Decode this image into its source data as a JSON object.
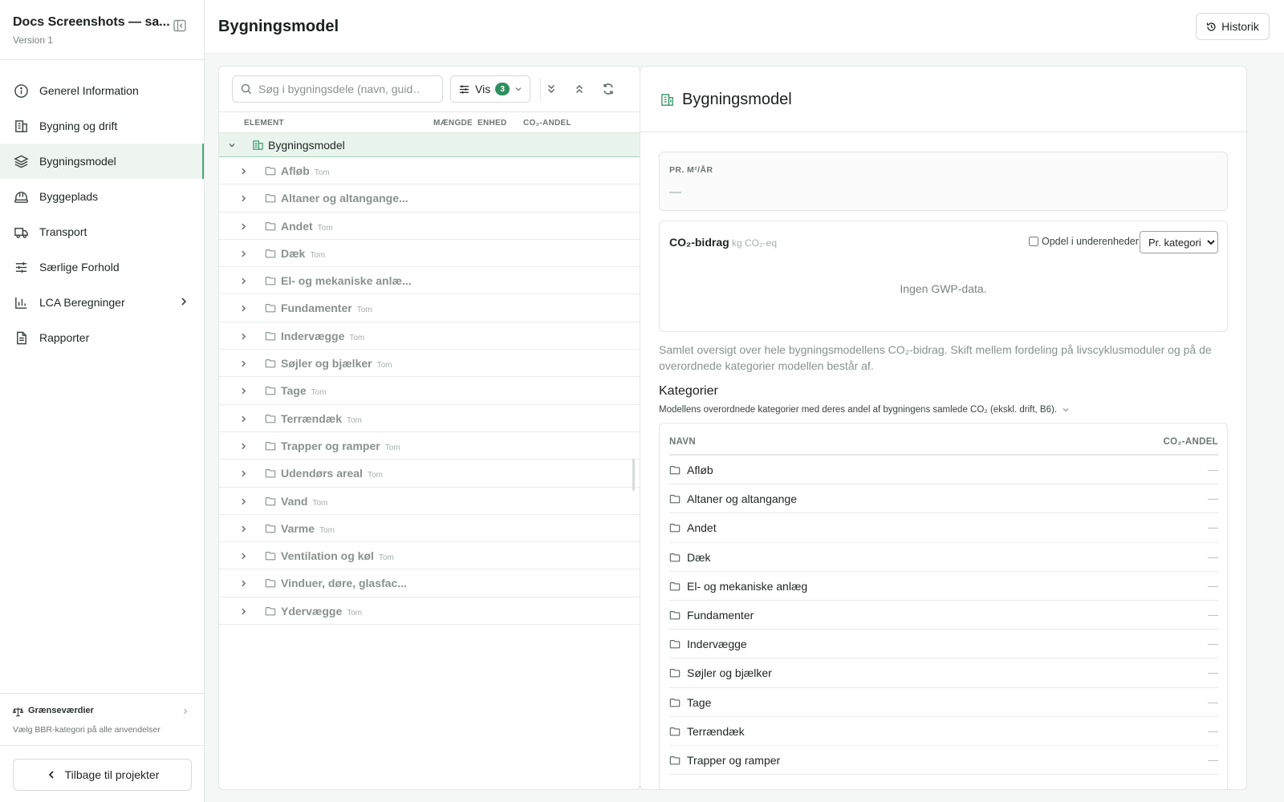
{
  "project": {
    "title": "Docs Screenshots — sa...",
    "version": "Version 1"
  },
  "nav": {
    "items": [
      {
        "label": "Generel Information",
        "icon": "info-icon"
      },
      {
        "label": "Bygning og drift",
        "icon": "building-icon"
      },
      {
        "label": "Bygningsmodel",
        "icon": "layers-icon",
        "active": true
      },
      {
        "label": "Byggeplads",
        "icon": "hard-hat-icon"
      },
      {
        "label": "Transport",
        "icon": "truck-icon"
      },
      {
        "label": "Særlige Forhold",
        "icon": "sliders-icon"
      },
      {
        "label": "LCA Beregninger",
        "icon": "bar-chart-icon"
      },
      {
        "label": "Rapporter",
        "icon": "document-icon"
      }
    ]
  },
  "limits": {
    "label": "Grænseværdier",
    "subtitle": "Vælg BBR-kategori på alle anvendelser"
  },
  "back_button": "Tilbage til projekter",
  "header": {
    "title": "Bygningsmodel",
    "history_button": "Historik"
  },
  "tree": {
    "search_placeholder": "Søg i bygningsdele (navn, guid…",
    "vis_label": "Vis",
    "vis_count": "3",
    "columns": {
      "element": "ELEMENT",
      "quantity": "MÆNGDE",
      "unit": "ENHED",
      "co2_share": "CO₂-ANDEL"
    },
    "root_label": "Bygningsmodel",
    "rows": [
      {
        "label": "Afløb",
        "tag": "Tom"
      },
      {
        "label": "Altaner og altangange...",
        "tag": ""
      },
      {
        "label": "Andet",
        "tag": "Tom"
      },
      {
        "label": "Dæk",
        "tag": "Tom"
      },
      {
        "label": "El- og mekaniske anlæ...",
        "tag": ""
      },
      {
        "label": "Fundamenter",
        "tag": "Tom"
      },
      {
        "label": "Indervægge",
        "tag": "Tom"
      },
      {
        "label": "Søjler og bjælker",
        "tag": "Tom"
      },
      {
        "label": "Tage",
        "tag": "Tom"
      },
      {
        "label": "Terrændæk",
        "tag": "Tom"
      },
      {
        "label": "Trapper og ramper",
        "tag": "Tom"
      },
      {
        "label": "Udendørs areal",
        "tag": "Tom"
      },
      {
        "label": "Vand",
        "tag": "Tom"
      },
      {
        "label": "Varme",
        "tag": "Tom"
      },
      {
        "label": "Ventilation og køl",
        "tag": "Tom"
      },
      {
        "label": "Vinduer, døre, glasfac...",
        "tag": ""
      },
      {
        "label": "Ydervægge",
        "tag": "Tom"
      }
    ]
  },
  "detail": {
    "title": "Bygningsmodel",
    "pr_label": "PR. M²/ÅR",
    "pr_value": "—",
    "co2_title": "CO₂-bidrag",
    "co2_unit": "kg CO₂-eq",
    "split_label": "Opdel i underenheder",
    "select_value": "Pr. kategori",
    "empty_text": "Ingen GWP-data.",
    "description": "Samlet oversigt over hele bygningsmodellens CO₂-bidrag. Skift mellem fordeling på livscyklusmoduler og på de overordnede kategorier modellen består af.",
    "categories_title": "Kategorier",
    "categories_subtitle": "Modellens overordnede kategorier med deres andel af bygningens samlede CO₂ (ekskl. drift, B6).",
    "table_headers": {
      "name": "NAVN",
      "share": "CO₂-ANDEL"
    },
    "categories": [
      {
        "name": "Afløb",
        "share": "—"
      },
      {
        "name": "Altaner og altangange",
        "share": "—"
      },
      {
        "name": "Andet",
        "share": "—"
      },
      {
        "name": "Dæk",
        "share": "—"
      },
      {
        "name": "El- og mekaniske anlæg",
        "share": "—"
      },
      {
        "name": "Fundamenter",
        "share": "—"
      },
      {
        "name": "Indervægge",
        "share": "—"
      },
      {
        "name": "Søjler og bjælker",
        "share": "—"
      },
      {
        "name": "Tage",
        "share": "—"
      },
      {
        "name": "Terrændæk",
        "share": "—"
      },
      {
        "name": "Trapper og ramper",
        "share": "—"
      }
    ]
  },
  "colors": {
    "accent": "#3f9a6c",
    "badge": "#2f8f5f",
    "active_bg": "#eef5f0"
  }
}
